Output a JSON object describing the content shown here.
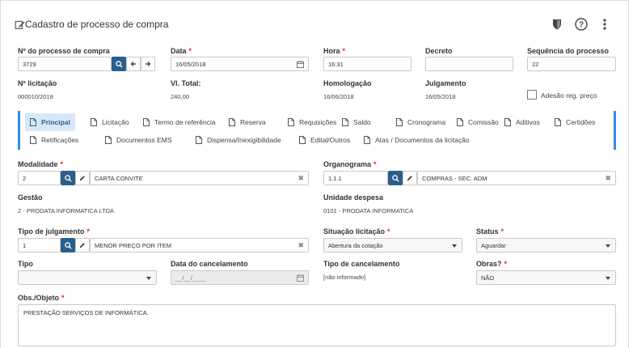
{
  "header": {
    "title": "Cadastro de processo de compra",
    "title_icon": "edit-icon",
    "tools": [
      "shield-icon",
      "help-icon",
      "more-vertical-icon"
    ]
  },
  "fields": {
    "num_processo": {
      "label": "Nº do processo de compra",
      "value": "3729"
    },
    "data": {
      "label": "Data",
      "value": "16/05/2018"
    },
    "hora": {
      "label": "Hora",
      "value": "16:31"
    },
    "decreto": {
      "label": "Decreto",
      "value": ""
    },
    "sequencia": {
      "label": "Sequência do processo",
      "value": "22"
    },
    "num_licitacao": {
      "label": "Nº licitação",
      "value": "000010/2018"
    },
    "vl_total": {
      "label": "Vl. Total:",
      "value": "240,00"
    },
    "homologacao": {
      "label": "Homologação",
      "value": "16/06/2018"
    },
    "julgamento": {
      "label": "Julgamento",
      "value": "16/05/2018"
    },
    "adesao": {
      "label": "Adesão reg. preço",
      "checked": false
    }
  },
  "tabs": [
    {
      "label": "Principal",
      "active": true
    },
    {
      "label": "Licitação"
    },
    {
      "label": "Termo de referência"
    },
    {
      "label": "Reserva"
    },
    {
      "label": "Requisições"
    },
    {
      "label": "Saldo"
    },
    {
      "label": "Cronograma"
    },
    {
      "label": "Comissão"
    },
    {
      "label": "Aditivos"
    },
    {
      "label": "Certidões"
    },
    {
      "label": "Retificações"
    },
    {
      "label": "Documentos EMS"
    },
    {
      "label": "Dispensa/Inexigibilidade"
    },
    {
      "label": "Edital/Outros"
    },
    {
      "label": "Atas / Documentos da licitação"
    }
  ],
  "principal": {
    "modalidade": {
      "label": "Modalidade",
      "code": "2",
      "desc": "CARTA CONVITE"
    },
    "organograma": {
      "label": "Organograma",
      "code": "1.1.1",
      "desc": "COMPRAS - SEC. ADM"
    },
    "gestao": {
      "label": "Gestão",
      "value": "2 - PRODATA INFORMATICA LTDA"
    },
    "unidade": {
      "label": "Unidade despesa",
      "value": "0101 - PRODATA INFORMATICA"
    },
    "tipo_julgamento": {
      "label": "Tipo de julgamento",
      "code": "1",
      "desc": "MENOR PREÇO POR ITEM"
    },
    "situacao": {
      "label": "Situação licitação",
      "value": "Abertura da cotação"
    },
    "status": {
      "label": "Status",
      "value": "Aguardar"
    },
    "tipo": {
      "label": "Tipo",
      "value": ""
    },
    "data_cancelamento": {
      "label": "Data do cancelamento",
      "placeholder": "__/__/____"
    },
    "tipo_cancelamento": {
      "label": "Tipo de cancelamento",
      "value": "[não informado]"
    },
    "obras": {
      "label": "Obras?",
      "value": "NÃO"
    },
    "obs": {
      "label": "Obs./Objeto",
      "value": "PRESTAÇÃO SERVIÇOS DE INFORMÁTICA."
    }
  }
}
